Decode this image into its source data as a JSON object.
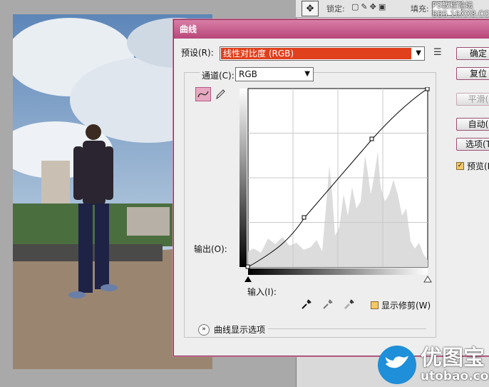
{
  "toolbar": {
    "lock_label": "锁定:",
    "fill_label": "填充:",
    "watermark_line1": "PS教程论坛",
    "watermark_line2": "BBS.16XX8.COM"
  },
  "dialog": {
    "title": "曲线",
    "preset_label": "预设(R):",
    "preset_value": "线性对比度 (RGB)",
    "channel_label": "通道(C):",
    "channel_value": "RGB",
    "output_label": "输出(O):",
    "input_label": "输入(I):",
    "show_clipping_label": "显示修剪(W)",
    "curve_display_options": "曲线显示选项",
    "buttons": {
      "ok": "确定",
      "reset": "复位",
      "smooth": "平滑(",
      "auto": "自动(",
      "options": "选项(T"
    },
    "preview_label": "预览(P"
  },
  "logo": {
    "name": "优图宝",
    "domain": "utobao.com"
  },
  "colors": {
    "title_bar": "#c4588a",
    "preset_highlight": "#e0401c",
    "logo_blue": "#1e8fd8"
  }
}
